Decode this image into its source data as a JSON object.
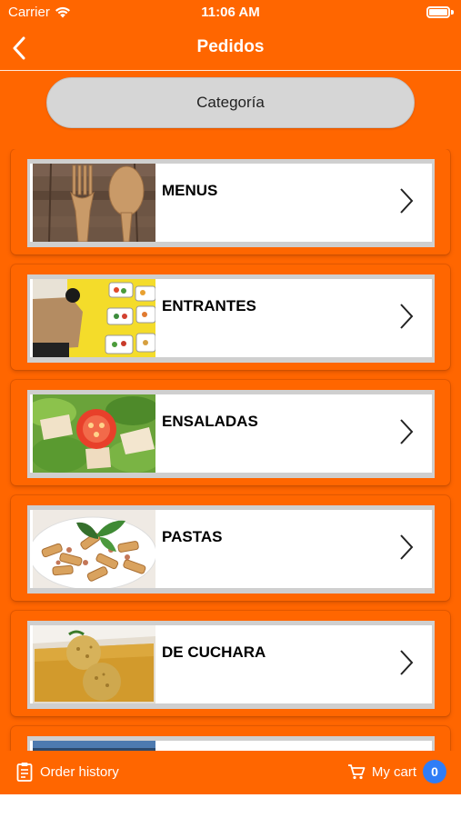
{
  "status_bar": {
    "carrier": "Carrier",
    "time": "11:06 AM"
  },
  "nav": {
    "title": "Pedidos",
    "back_icon": "chevron-left-icon"
  },
  "category": {
    "label": "Categoría"
  },
  "categories": [
    {
      "label": "MENUS",
      "image": "cutlery-image"
    },
    {
      "label": "ENTRANTES",
      "image": "takeaway-image"
    },
    {
      "label": "ENSALADAS",
      "image": "salad-image"
    },
    {
      "label": "PASTAS",
      "image": "pasta-image"
    },
    {
      "label": "DE CUCHARA",
      "image": "soup-image"
    },
    {
      "label": "",
      "image": "partial-image"
    }
  ],
  "tab_bar": {
    "history_label": "Order history",
    "cart_label": "My cart",
    "cart_count": "0"
  },
  "colors": {
    "primary": "#ff6600",
    "card_border": "#cfcfcf",
    "badge": "#2f7df6"
  }
}
